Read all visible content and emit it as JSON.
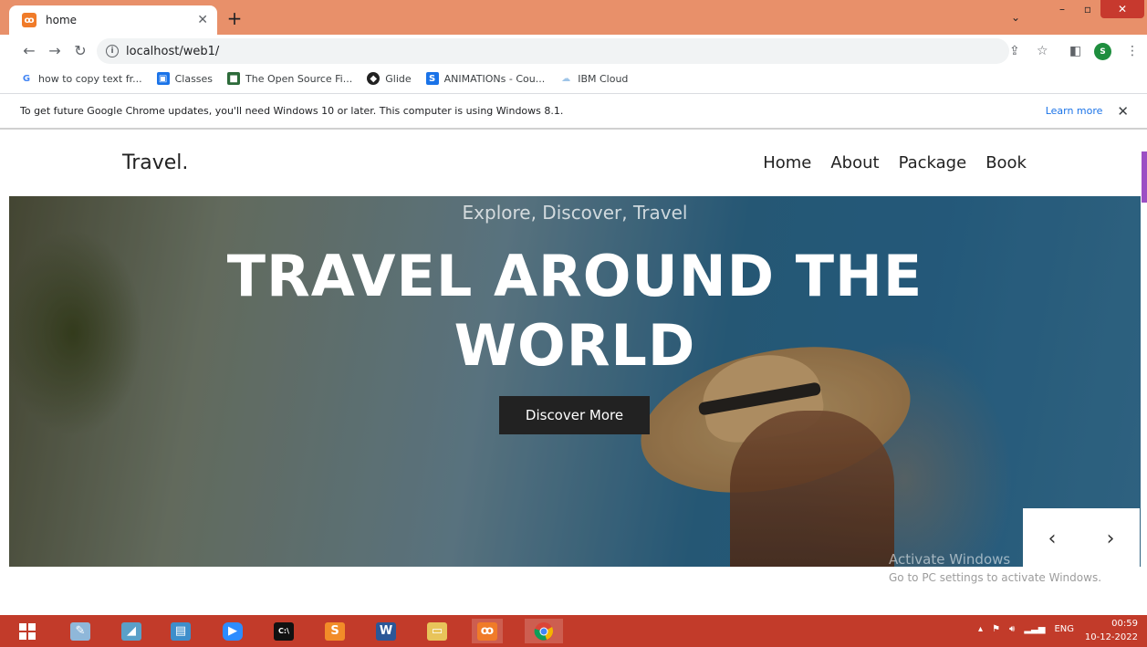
{
  "browser": {
    "tab_title": "home",
    "tab_favicon": "xampp-icon",
    "new_tab_label": "+",
    "address": "localhost/web1/",
    "profile_initial": "S",
    "bookmarks": [
      {
        "label": "how to copy text fr...",
        "icon": "google-icon",
        "color": "#4285f4",
        "glyph": "G"
      },
      {
        "label": "Classes",
        "icon": "classroom-icon",
        "color": "#1a73e8",
        "glyph": "▣"
      },
      {
        "label": "The Open Source Fi...",
        "icon": "site-icon",
        "color": "#2d6b3a",
        "glyph": "■"
      },
      {
        "label": "Glide",
        "icon": "glide-icon",
        "color": "#222222",
        "glyph": "◆"
      },
      {
        "label": "ANIMATIONs - Cou...",
        "icon": "s-icon",
        "color": "#1a73e8",
        "glyph": "S"
      },
      {
        "label": "IBM Cloud",
        "icon": "cloud-icon",
        "color": "#9fc5e8",
        "glyph": "☁"
      }
    ],
    "infobar": {
      "message": "To get future Google Chrome updates, you'll need Windows 10 or later. This computer is using Windows 8.1.",
      "link": "Learn more"
    }
  },
  "site": {
    "logo": "Travel.",
    "nav": [
      "Home",
      "About",
      "Package",
      "Book"
    ],
    "hero": {
      "subtitle": "Explore, Discover, Travel",
      "title_line1": "TRAVEL AROUND THE",
      "title_line2": "WORLD",
      "button": "Discover More"
    },
    "slider": {
      "prev": "‹",
      "next": "›"
    }
  },
  "watermark": {
    "line1": "Activate Windows",
    "line2": "Go to PC settings to activate Windows."
  },
  "taskbar": {
    "apps": [
      {
        "name": "start-icon"
      },
      {
        "name": "paint-icon"
      },
      {
        "name": "app-icon"
      },
      {
        "name": "explorer-window-icon"
      },
      {
        "name": "zoom-icon"
      },
      {
        "name": "cmd-icon"
      },
      {
        "name": "sublime-icon"
      },
      {
        "name": "word-icon"
      },
      {
        "name": "file-explorer-icon"
      },
      {
        "name": "xampp-icon"
      },
      {
        "name": "chrome-icon"
      }
    ],
    "language": "ENG",
    "time": "00:59",
    "date": "10-12-2022"
  }
}
